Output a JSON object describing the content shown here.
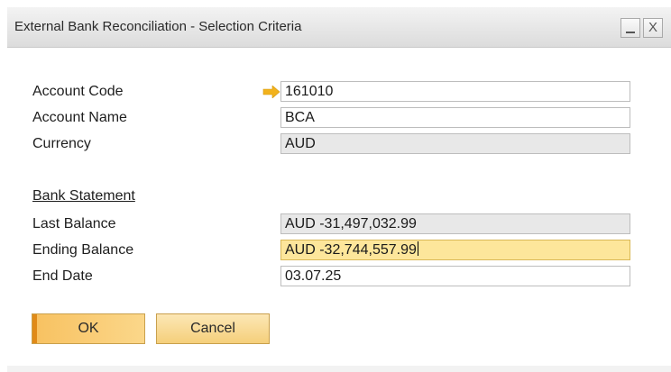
{
  "window": {
    "title": "External Bank Reconciliation - Selection Criteria",
    "minimize_label": "_",
    "close_label": "X"
  },
  "form": {
    "account_code": {
      "label": "Account Code",
      "value": "161010"
    },
    "account_name": {
      "label": "Account Name",
      "value": "BCA"
    },
    "currency": {
      "label": "Currency",
      "value": "AUD"
    },
    "bank_statement_heading": "Bank Statement",
    "last_balance": {
      "label": "Last Balance",
      "value": "AUD -31,497,032.99"
    },
    "ending_balance": {
      "label": "Ending Balance",
      "value": "AUD -32,744,557.99"
    },
    "end_date": {
      "label": "End Date",
      "value": "03.07.25"
    }
  },
  "buttons": {
    "ok_label": "OK",
    "cancel_label": "Cancel"
  },
  "colors": {
    "accent": "#f8c262",
    "active_field": "#fde69b",
    "readonly_field": "#e8e8e8",
    "arrow": "#f2b21c"
  },
  "icons": {
    "link_arrow": "arrow-right-icon"
  }
}
